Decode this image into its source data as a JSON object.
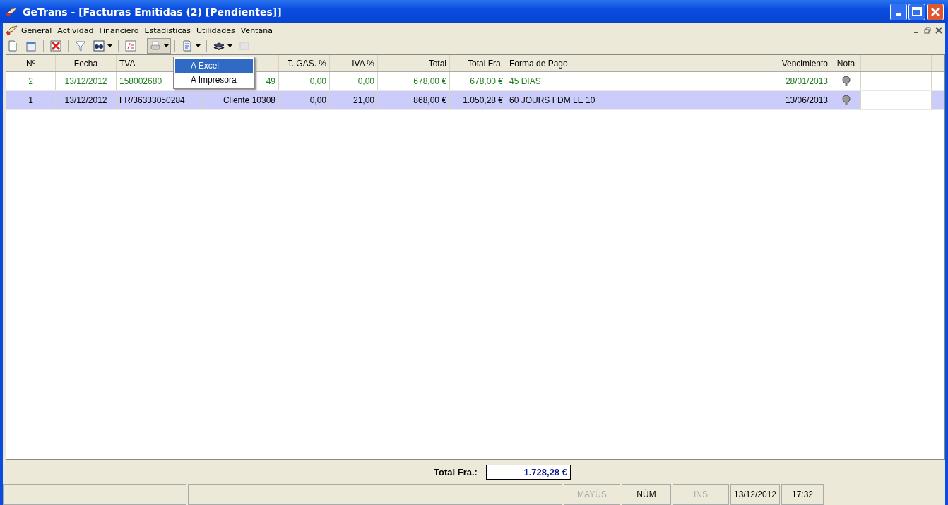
{
  "window": {
    "title": "GeTrans - [Facturas Emitidas (2) [Pendientes]]"
  },
  "menu": [
    "General",
    "Actividad",
    "Financiero",
    "Estadisticas",
    "Utilidades",
    "Ventana"
  ],
  "toolbar": [
    {
      "kind": "new",
      "dropdown": false,
      "pressed": false,
      "disabled": false
    },
    {
      "kind": "properties",
      "dropdown": false,
      "pressed": false,
      "disabled": false
    },
    {
      "kind": "sep"
    },
    {
      "kind": "delete",
      "dropdown": false,
      "pressed": false,
      "disabled": false
    },
    {
      "kind": "sep"
    },
    {
      "kind": "filter",
      "dropdown": false,
      "pressed": false,
      "disabled": false
    },
    {
      "kind": "find",
      "dropdown": true,
      "pressed": false,
      "disabled": false
    },
    {
      "kind": "sep"
    },
    {
      "kind": "formula",
      "dropdown": false,
      "pressed": false,
      "disabled": false
    },
    {
      "kind": "sep"
    },
    {
      "kind": "print",
      "dropdown": true,
      "pressed": true,
      "disabled": false
    },
    {
      "kind": "sep"
    },
    {
      "kind": "document",
      "dropdown": true,
      "pressed": false,
      "disabled": false
    },
    {
      "kind": "sep"
    },
    {
      "kind": "layers",
      "dropdown": true,
      "pressed": false,
      "disabled": false
    },
    {
      "kind": "next",
      "dropdown": false,
      "pressed": false,
      "disabled": true
    }
  ],
  "dropdown_menu": [
    {
      "label": "A Excel",
      "selected": true
    },
    {
      "label": "A Impresora",
      "selected": false
    }
  ],
  "table": {
    "columns": [
      {
        "label": "Nº"
      },
      {
        "label": "Fecha"
      },
      {
        "label": "TVA"
      },
      {},
      {
        "label": "T. GAS. %"
      },
      {
        "label": "IVA %"
      },
      {
        "label": "Total"
      },
      {
        "label": "Total Fra."
      },
      {
        "label": "Forma de Pago"
      },
      {
        "label": "Vencimiento"
      },
      {
        "label": "Nota"
      },
      {}
    ],
    "rows": [
      {
        "selected": false,
        "color": "#1e7d1e",
        "cells": [
          "2",
          "13/12/2012",
          "158002680",
          "49",
          "0,00",
          "0,00",
          "678,00 €",
          "678,00 €",
          "45 DIAS",
          "28/01/2013"
        ]
      },
      {
        "selected": true,
        "color": "#000000",
        "cells": [
          "1",
          "13/12/2012",
          "FR/36333050284",
          "Cliente 10308",
          "0,00",
          "21,00",
          "868,00 €",
          "1.050,28 €",
          "60 JOURS FDM LE 10",
          "13/06/2013"
        ]
      }
    ]
  },
  "total": {
    "label": "Total Fra.:",
    "value": "1.728,28 €"
  },
  "status_bar": [
    {
      "text": "MAYÚS",
      "disabled": true
    },
    {
      "text": "NÚM",
      "disabled": false
    },
    {
      "text": "INS",
      "disabled": true
    },
    {
      "text": "13/12/2012",
      "disabled": false
    },
    {
      "text": "17:32",
      "disabled": false
    }
  ]
}
